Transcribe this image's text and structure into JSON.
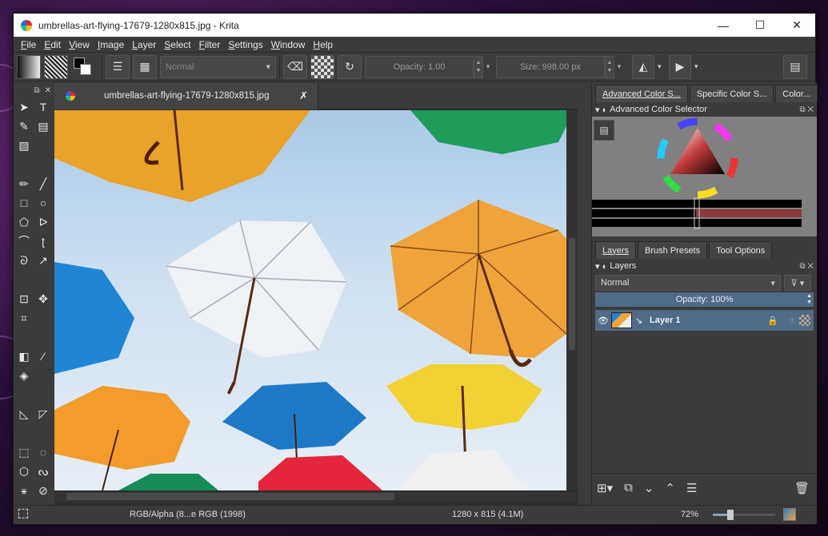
{
  "window": {
    "title": "umbrellas-art-flying-17679-1280x815.jpg  - Krita",
    "minimize": "—",
    "maximize": "☐",
    "close": "✕"
  },
  "menu": [
    "File",
    "Edit",
    "View",
    "Image",
    "Layer",
    "Select",
    "Filter",
    "Settings",
    "Window",
    "Help"
  ],
  "toolbar": {
    "blend_mode": "Normal",
    "opacity_label": "Opacity:  1.00",
    "size_label": "Size:  998.00 px"
  },
  "document": {
    "tab_title": "umbrellas-art-flying-17679-1280x815.jpg",
    "close": "✗"
  },
  "right_dock": {
    "top_tabs": [
      "Advanced Color S...",
      "Specific Color S...",
      "Color..."
    ],
    "color_panel_title": "Advanced Color Selector",
    "layer_tabs": [
      "Layers",
      "Brush Presets",
      "Tool Options"
    ],
    "layers_panel_title": "Layers",
    "layer_blend": "Normal",
    "layer_opacity": "Opacity:  100%",
    "layers": [
      {
        "name": "Layer 1"
      }
    ]
  },
  "status": {
    "color_space": "RGB/Alpha (8...e RGB (1998)",
    "dimensions": "1280 x 815 (4.1M)",
    "zoom": "72%"
  },
  "colors": {
    "accent": "#4f6b88",
    "panel_bg": "#3b3b3b"
  }
}
